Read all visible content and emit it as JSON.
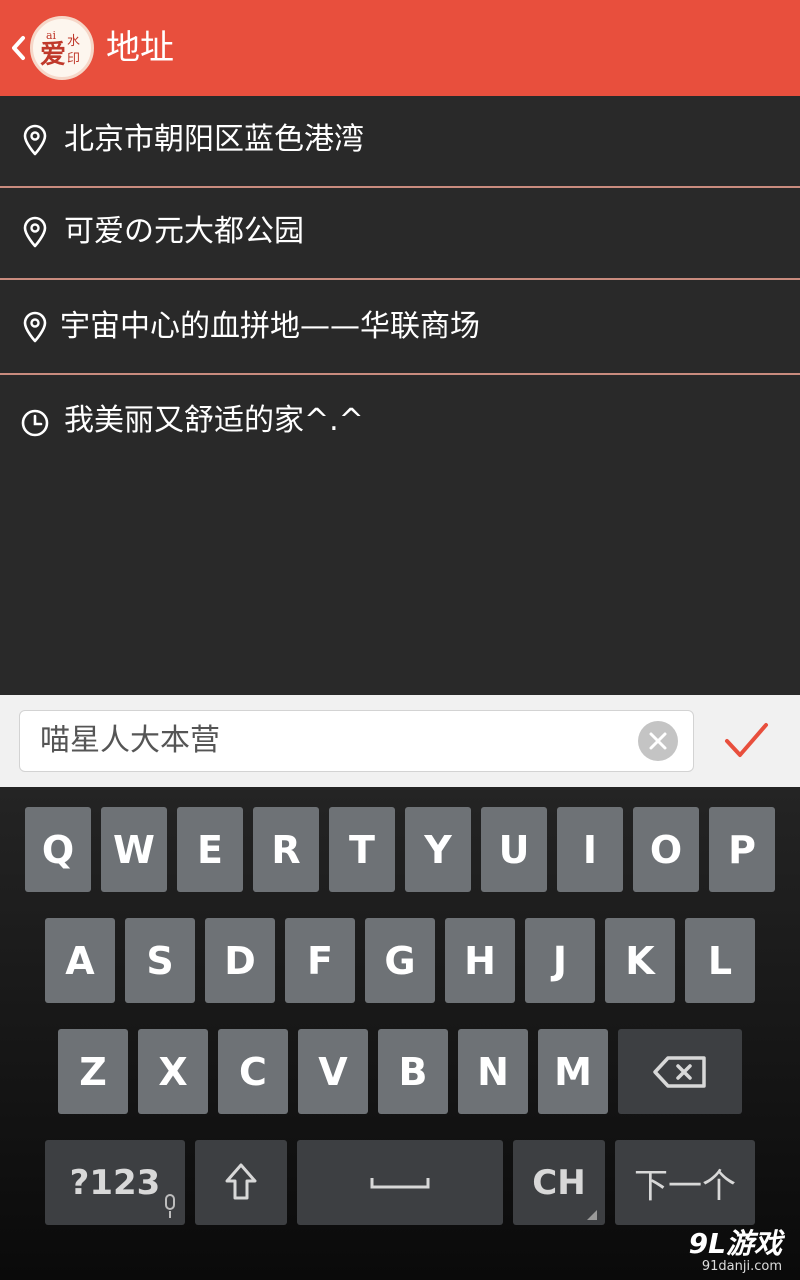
{
  "header": {
    "title": "地址",
    "logo_text_top": "ai",
    "logo_text_main": "爱",
    "logo_text_side1": "水",
    "logo_text_side2": "印",
    "bg_color": "#e84f3d"
  },
  "locations": [
    {
      "label": "北京市朝阳区蓝色港湾",
      "icon": "location-pin-icon"
    },
    {
      "label": "可爱の元大都公园",
      "icon": "location-pin-icon"
    },
    {
      "label": "宇宙中心的血拼地——华联商场",
      "icon": "location-pin-icon"
    },
    {
      "label": "我美丽又舒适的家^.^",
      "icon": "clock-icon"
    }
  ],
  "input": {
    "value": "喵星人大本营",
    "clear_icon": "clear-icon",
    "confirm_icon": "checkmark-icon",
    "accent_color": "#e84f3d"
  },
  "keyboard": {
    "row1": [
      "Q",
      "W",
      "E",
      "R",
      "T",
      "Y",
      "U",
      "I",
      "O",
      "P"
    ],
    "row2": [
      "A",
      "S",
      "D",
      "F",
      "G",
      "H",
      "J",
      "K",
      "L"
    ],
    "row3": [
      "Z",
      "X",
      "C",
      "V",
      "B",
      "N",
      "M"
    ],
    "symbols_label": "?123",
    "language_label": "CH",
    "next_label": "下一个"
  },
  "watermark": {
    "main": "9L游戏",
    "sub": "91danji.com"
  }
}
